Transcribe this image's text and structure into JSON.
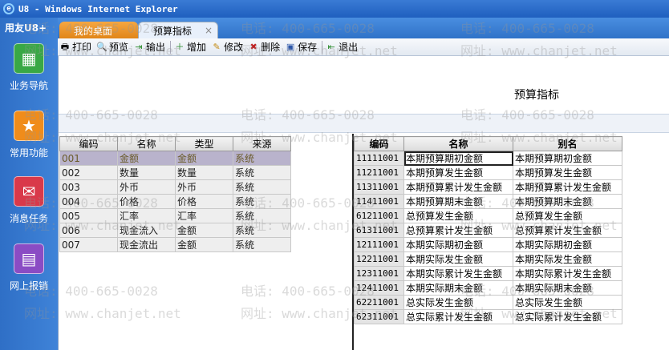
{
  "window": {
    "title": "U8 - Windows Internet Explorer",
    "ie_glyph": "e"
  },
  "brand": "用友U8+",
  "leftnav": [
    {
      "label": "业务导航"
    },
    {
      "label": "常用功能"
    },
    {
      "label": "消息任务"
    },
    {
      "label": "网上报销"
    }
  ],
  "tabs": {
    "home": "我的桌面",
    "budget": "预算指标",
    "close": "×"
  },
  "toolbar": {
    "print": "打印",
    "preview": "预览",
    "export": "输出",
    "add": "增加",
    "edit": "修改",
    "delete": "删除",
    "save": "保存",
    "exit": "退出"
  },
  "page_title": "预算指标",
  "left_grid": {
    "headers": [
      "编码",
      "名称",
      "类型",
      "来源"
    ],
    "rows": [
      [
        "001",
        "金额",
        "金额",
        "系统"
      ],
      [
        "002",
        "数量",
        "数量",
        "系统"
      ],
      [
        "003",
        "外币",
        "外币",
        "系统"
      ],
      [
        "004",
        "价格",
        "价格",
        "系统"
      ],
      [
        "005",
        "汇率",
        "汇率",
        "系统"
      ],
      [
        "006",
        "现金流入",
        "金额",
        "系统"
      ],
      [
        "007",
        "现金流出",
        "金额",
        "系统"
      ]
    ]
  },
  "right_grid": {
    "headers": [
      "编码",
      "名称",
      "别名"
    ],
    "rows": [
      [
        "11111001",
        "本期预算期初金额",
        "本期预算期初金额"
      ],
      [
        "11211001",
        "本期预算发生金额",
        "本期预算发生金额"
      ],
      [
        "11311001",
        "本期预算累计发生金额",
        "本期预算累计发生金额"
      ],
      [
        "11411001",
        "本期预算期末金额",
        "本期预算期末金额"
      ],
      [
        "61211001",
        "总预算发生金额",
        "总预算发生金额"
      ],
      [
        "61311001",
        "总预算累计发生金额",
        "总预算累计发生金额"
      ],
      [
        "12111001",
        "本期实际期初金额",
        "本期实际期初金额"
      ],
      [
        "12211001",
        "本期实际发生金额",
        "本期实际发生金额"
      ],
      [
        "12311001",
        "本期实际累计发生金额",
        "本期实际累计发生金额"
      ],
      [
        "12411001",
        "本期实际期末金额",
        "本期实际期末金额"
      ],
      [
        "62211001",
        "总实际发生金额",
        "总实际发生金额"
      ],
      [
        "62311001",
        "总实际累计发生金额",
        "总实际累计发生金额"
      ]
    ]
  },
  "watermark": {
    "phone": "电话: 400-665-0028",
    "site": "网址: www.chanjet.net"
  }
}
